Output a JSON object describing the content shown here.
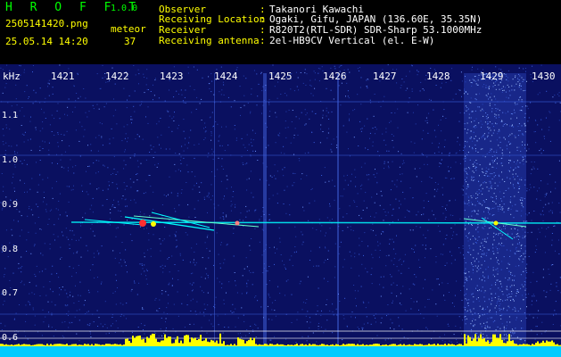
{
  "app": {
    "title": "H R O F F T",
    "version": "1.0.0",
    "filename": "2505141420.png",
    "timestamp": "25.05.14 14:20",
    "category": "meteor",
    "count": "37"
  },
  "info": [
    {
      "label": "Observer",
      "value": "Takanori Kawachi"
    },
    {
      "label": "Receiving Location",
      "value": "Ogaki, Gifu, JAPAN (136.60E, 35.35N)"
    },
    {
      "label": "Receiver",
      "value": "R820T2(RTL-SDR) SDR-Sharp 53.1000MHz"
    },
    {
      "label": "Receiving antenna",
      "value": "2el-HB9CV Vertical (el. E-W)"
    }
  ],
  "axes": {
    "x_unit": "",
    "y_unit": "kHz",
    "x_ticks": [
      "1421",
      "1422",
      "1423",
      "1424",
      "1425",
      "1426",
      "1427",
      "1428",
      "1429",
      "1430"
    ],
    "y_ticks": [
      "1.1",
      "1.0",
      "0.9",
      "0.8",
      "0.7",
      "0.6"
    ]
  },
  "colors": {
    "background": "#0a1060",
    "noise": "#2a4cd0",
    "signal": "#00ffff",
    "power": "#ffff00",
    "label": "#00ff00"
  }
}
